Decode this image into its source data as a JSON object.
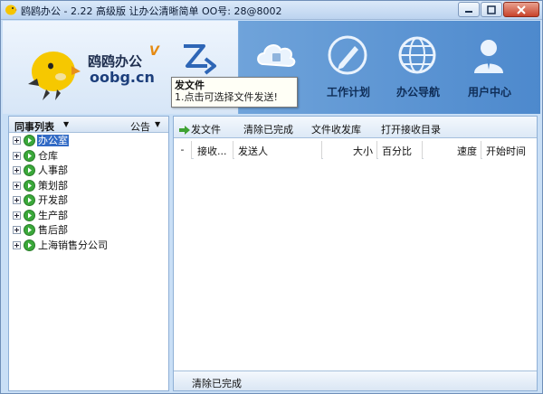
{
  "window": {
    "title": "鸥鸥办公 - 2.22 高级版 让办公清晰简单 OO号: 28@8002"
  },
  "logo": {
    "name": "鸥鸥办公",
    "version_mark": "V",
    "domain": "oobg.cn"
  },
  "nav": {
    "items": [
      {
        "label": "",
        "icon": "cloud-icon"
      },
      {
        "label": "工作计划",
        "icon": "pen-icon"
      },
      {
        "label": "办公导航",
        "icon": "globe-icon"
      },
      {
        "label": "用户中心",
        "icon": "user-icon"
      }
    ]
  },
  "tooltip": {
    "title": "发文件",
    "body": "1.点击可选择文件发送!"
  },
  "left_panel": {
    "header": "同事列表",
    "notice": "公告",
    "groups": [
      {
        "label": "办公室",
        "selected": true
      },
      {
        "label": "仓库"
      },
      {
        "label": "人事部"
      },
      {
        "label": "策划部"
      },
      {
        "label": "开发部"
      },
      {
        "label": "生产部"
      },
      {
        "label": "售后部"
      },
      {
        "label": "上海销售分公司"
      }
    ]
  },
  "toolbar": {
    "send_file": "发文件",
    "clear_done": "清除已完成",
    "file_box": "文件收发库",
    "open_dir": "打开接收目录"
  },
  "grid": {
    "columns": [
      "-",
      "接收...",
      "发送人",
      "大小",
      "百分比",
      "速度",
      "开始时间"
    ]
  },
  "statusbar": {
    "text": "清除已完成"
  },
  "colors": {
    "header_blue": "#4d89cd",
    "selection": "#316ac5",
    "panel_border": "#8fb0d6"
  }
}
